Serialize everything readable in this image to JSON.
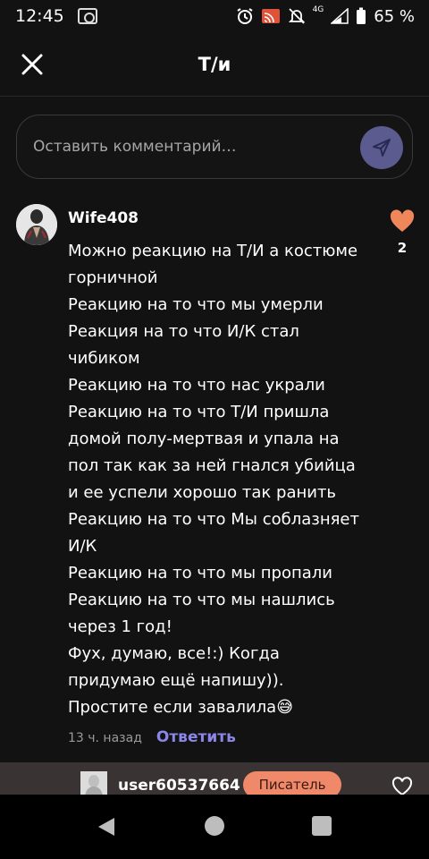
{
  "status_bar": {
    "time": "12:45",
    "network": "4G",
    "battery": "65 %"
  },
  "header": {
    "title": "Т/и"
  },
  "comment_input": {
    "placeholder": "Оставить комментарий…"
  },
  "comment": {
    "username": "Wife408",
    "lines": [
      "Можно реакцию на Т/И а костюме",
      "горничной",
      "Реакцию на то что мы умерли",
      "Реакция на то что И/К стал",
      "чибиком",
      "Реакцию на то что нас украли",
      "Реакцию на то что Т/И пришла",
      "домой полу-мертвая и упала на",
      "пол так как за ней гнался убийца",
      "и ее успели хорошо так ранить",
      "Реакцию на то что Мы соблазняет",
      "И/К",
      "Реакцию на то что мы пропали",
      "Реакцию на то что мы нашлись",
      "через 1 год!",
      "Фух, думаю, все!:) Когда",
      "придумаю ещё напишу)).",
      "Простите если завалила😅"
    ],
    "likes": "2",
    "time_ago": "13 ч. назад",
    "reply_label": "Ответить"
  },
  "author_bar": {
    "username": "user60537664",
    "badge": "Писатель"
  },
  "colors": {
    "accent": "#8b86e8",
    "like": "#f0875a",
    "send_button": "#5c5b90",
    "badge": "#f0896a"
  }
}
